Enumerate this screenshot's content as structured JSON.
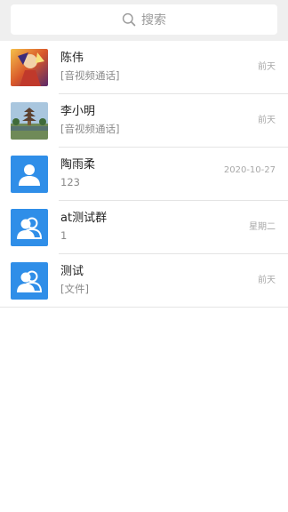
{
  "search": {
    "placeholder": "搜索"
  },
  "conversations": [
    {
      "name": "陈伟",
      "preview": "[音视频通话]",
      "time": "前天",
      "avatar": "photo-hero-icon"
    },
    {
      "name": "李小明",
      "preview": "[音视频通话]",
      "time": "前天",
      "avatar": "photo-pagoda-icon"
    },
    {
      "name": "陶雨柔",
      "preview": "123",
      "time": "2020-10-27",
      "avatar": "person-icon"
    },
    {
      "name": "at测试群",
      "preview": "1",
      "time": "星期二",
      "avatar": "group-icon"
    },
    {
      "name": "测试",
      "preview": "[文件]",
      "time": "前天",
      "avatar": "group-icon"
    }
  ],
  "colors": {
    "accent": "#2f8ee8",
    "background": "#efefef"
  }
}
